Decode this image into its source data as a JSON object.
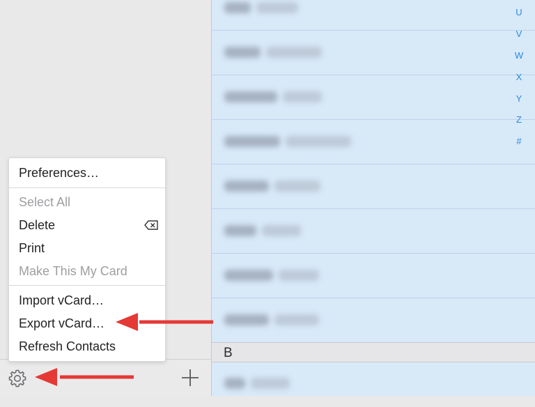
{
  "menu": {
    "items": [
      {
        "label": "Preferences…",
        "enabled": true
      },
      {
        "label": "Select All",
        "enabled": false
      },
      {
        "label": "Delete",
        "enabled": true
      },
      {
        "label": "Print",
        "enabled": true
      },
      {
        "label": "Make This My Card",
        "enabled": false
      },
      {
        "label": "Import vCard…",
        "enabled": true
      },
      {
        "label": "Export vCard…",
        "enabled": true
      },
      {
        "label": "Refresh Contacts",
        "enabled": true
      }
    ]
  },
  "toolbar": {
    "settings_icon": "gear-icon",
    "add_icon": "plus-icon"
  },
  "index": [
    "U",
    "V",
    "W",
    "X",
    "Y",
    "Z",
    "#"
  ],
  "section_b": "B",
  "colors": {
    "list_bg": "#d8e9f8",
    "index_text": "#2b8ad8",
    "arrow": "#e53935",
    "sidebar_bg": "#e9e9ea"
  }
}
